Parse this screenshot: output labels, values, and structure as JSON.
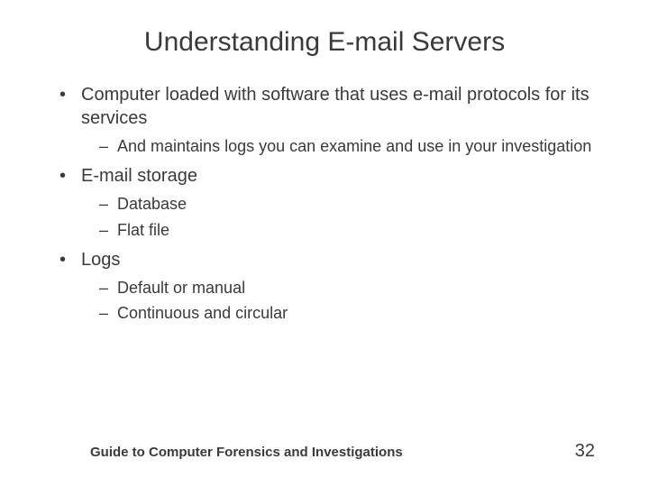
{
  "title": "Understanding E-mail Servers",
  "bullets": [
    {
      "text": "Computer loaded with software that uses e-mail protocols for its services",
      "sub": [
        "And maintains logs you can examine and use in your investigation"
      ]
    },
    {
      "text": "E-mail storage",
      "sub": [
        "Database",
        "Flat file"
      ]
    },
    {
      "text": "Logs",
      "sub": [
        "Default or manual",
        "Continuous and circular"
      ]
    }
  ],
  "footer": {
    "text": "Guide to Computer Forensics and Investigations",
    "page": "32"
  }
}
